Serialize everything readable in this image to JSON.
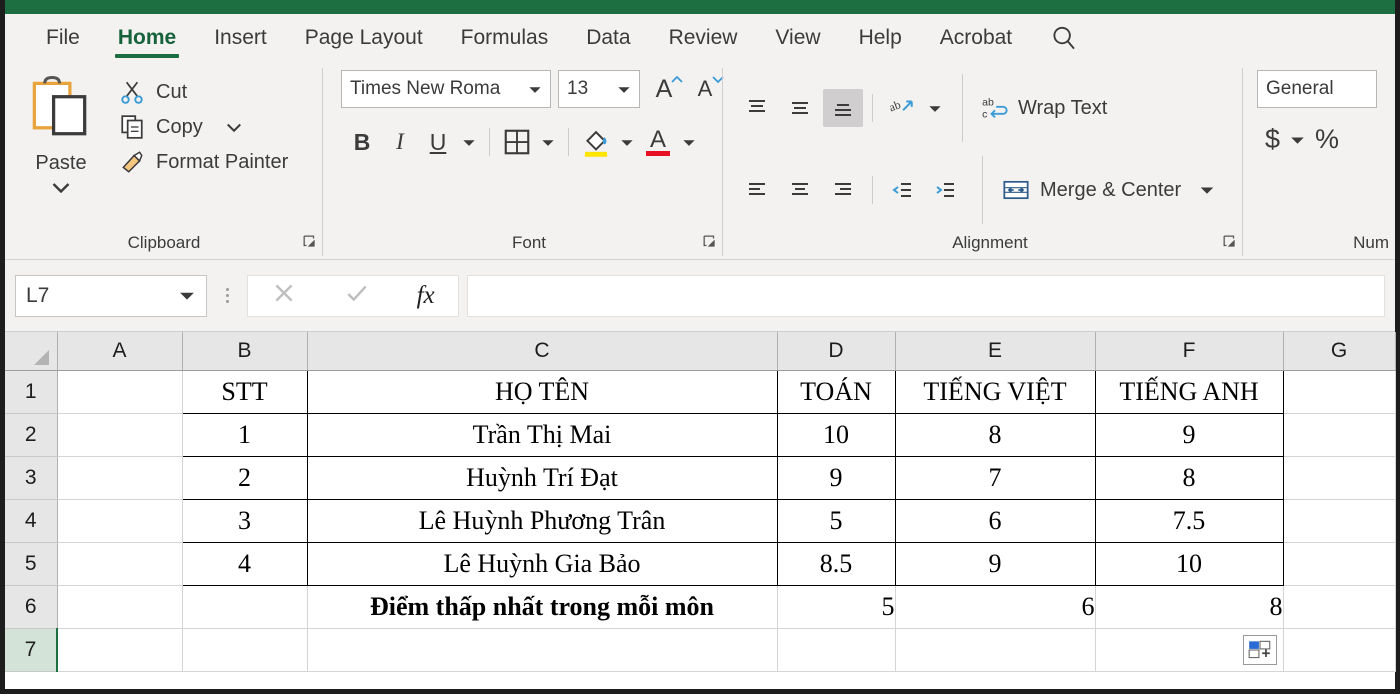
{
  "window": {
    "title_bar_color": "#1d6f42"
  },
  "ribbon": {
    "tabs": [
      {
        "label": "File",
        "active": false
      },
      {
        "label": "Home",
        "active": true
      },
      {
        "label": "Insert",
        "active": false
      },
      {
        "label": "Page Layout",
        "active": false
      },
      {
        "label": "Formulas",
        "active": false
      },
      {
        "label": "Data",
        "active": false
      },
      {
        "label": "Review",
        "active": false
      },
      {
        "label": "View",
        "active": false
      },
      {
        "label": "Help",
        "active": false
      },
      {
        "label": "Acrobat",
        "active": false
      }
    ],
    "search_icon": "search-icon",
    "groups": {
      "clipboard": {
        "label": "Clipboard",
        "paste": "Paste",
        "cut": "Cut",
        "copy": "Copy",
        "format_painter": "Format Painter"
      },
      "font": {
        "label": "Font",
        "font_name": "Times New Roma",
        "font_size": "13",
        "grow_font": "A",
        "shrink_font": "A",
        "bold": "B",
        "italic": "I",
        "underline": "U"
      },
      "alignment": {
        "label": "Alignment",
        "wrap_text": "Wrap Text",
        "merge_center": "Merge & Center"
      },
      "number": {
        "label": "Num",
        "format": "General",
        "currency": "$",
        "percent": "%"
      }
    }
  },
  "formula_bar": {
    "name_box": "L7",
    "cancel_icon": "cancel-icon",
    "enter_icon": "confirm-icon",
    "function_icon": "fx",
    "formula_value": ""
  },
  "sheet": {
    "columns": [
      "A",
      "B",
      "C",
      "D",
      "E",
      "F",
      "G"
    ],
    "rows": [
      "1",
      "2",
      "3",
      "4",
      "5",
      "6",
      "7"
    ],
    "selected_cell": "L7",
    "selected_row": "7",
    "quick_analysis_icon": "quick-analysis-icon",
    "data": {
      "headers": {
        "b": "STT",
        "c": "HỌ TÊN",
        "d": "TOÁN",
        "e": "TIẾNG VIỆT",
        "f": "TIẾNG ANH"
      },
      "records": [
        {
          "stt": "1",
          "name": "Trần Thị Mai",
          "toan": "10",
          "tv": "8",
          "ta": "9"
        },
        {
          "stt": "2",
          "name": "Huỳnh Trí Đạt",
          "toan": "9",
          "tv": "7",
          "ta": "8"
        },
        {
          "stt": "3",
          "name": "Lê Huỳnh Phương Trân",
          "toan": "5",
          "tv": "6",
          "ta": "7.5"
        },
        {
          "stt": "4",
          "name": "Lê Huỳnh Gia Bảo",
          "toan": "8.5",
          "tv": "9",
          "ta": "10"
        }
      ],
      "summary": {
        "label": "Điểm thấp nhất trong mỗi môn",
        "toan": "5",
        "tv": "6",
        "ta": "8"
      }
    }
  }
}
